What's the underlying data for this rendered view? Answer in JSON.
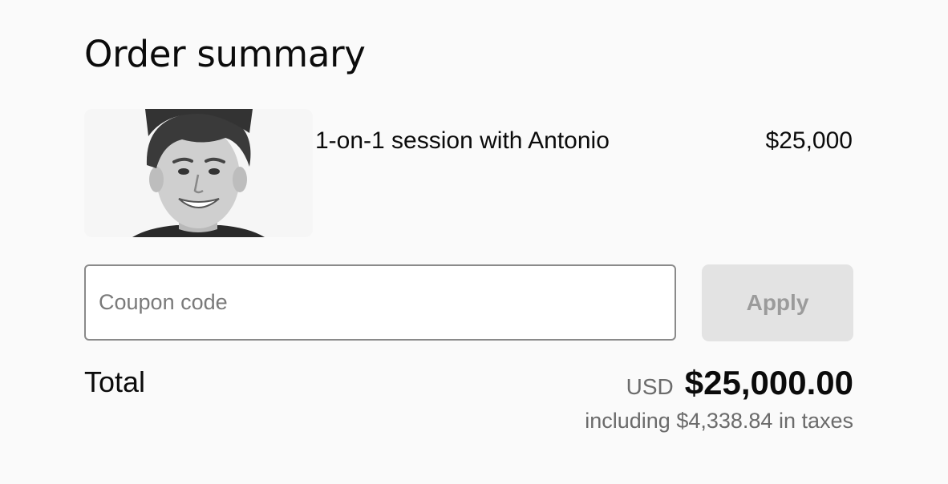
{
  "order": {
    "title": "Order summary",
    "item": {
      "name": "1-on-1 session with Antonio",
      "price": "$25,000",
      "image_alt": "Antonio portrait"
    }
  },
  "coupon": {
    "placeholder": "Coupon code",
    "apply_label": "Apply"
  },
  "total": {
    "label": "Total",
    "currency": "USD",
    "amount": "$25,000.00",
    "tax_note": "including $4,338.84 in taxes"
  }
}
